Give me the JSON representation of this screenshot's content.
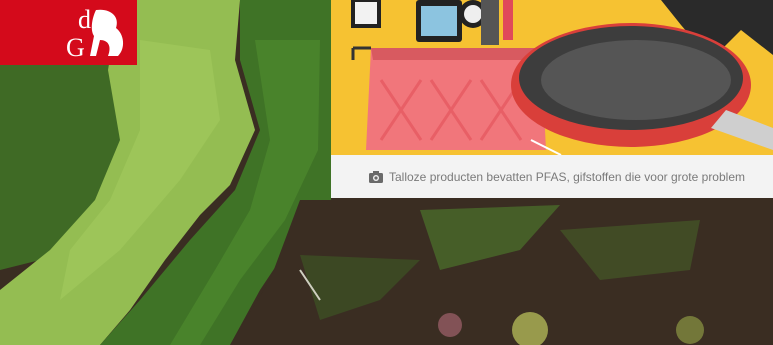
{
  "logo": {
    "text": "dG",
    "color": "#d40a1b"
  },
  "card": {
    "caption": "Talloze producten bevatten PFAS, gifstoffen die voor grote problem",
    "caption_icon": "camera-icon",
    "illustration_background": "#f6c232"
  },
  "scene": {
    "description_colors": {
      "duckweed": "#94bd52",
      "grass": "#3f6a25",
      "soil": "#3a2d22"
    }
  }
}
